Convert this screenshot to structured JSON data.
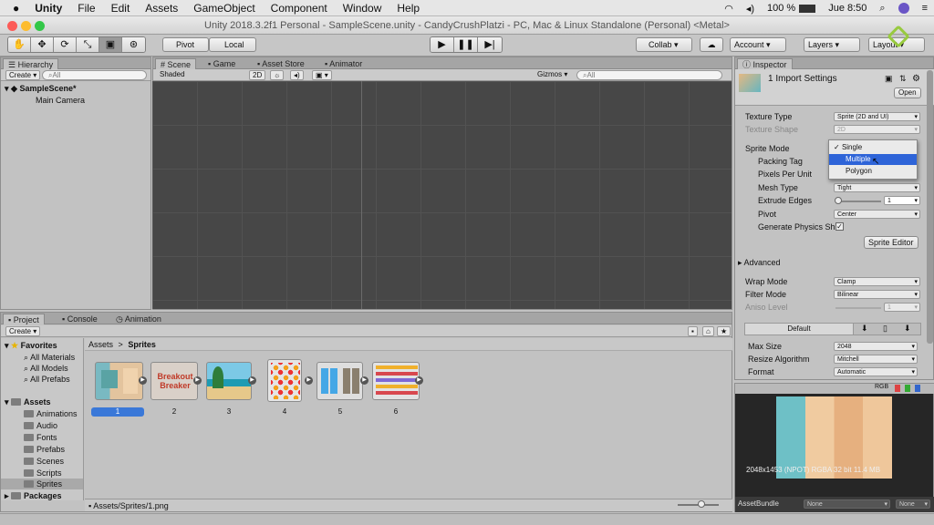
{
  "menubar": {
    "apple": "",
    "app": "Unity",
    "items": [
      "File",
      "Edit",
      "Assets",
      "GameObject",
      "Component",
      "Window",
      "Help"
    ],
    "battery": "100 %",
    "day_time": "Jue 8:50"
  },
  "window": {
    "title": "Unity 2018.3.2f1 Personal - SampleScene.unity - CandyCrushPlatzi - PC, Mac & Linux Standalone (Personal) <Metal>"
  },
  "toolbar": {
    "pivot": "Pivot",
    "local": "Local",
    "collab": "Collab",
    "account": "Account",
    "layers": "Layers",
    "layout": "Layout"
  },
  "hierarchy": {
    "tab": "Hierarchy",
    "create": "Create",
    "search": "All",
    "scene": "SampleScene*",
    "items": [
      "Main Camera"
    ]
  },
  "scene_panel": {
    "tabs": [
      "Scene",
      "Game",
      "Asset Store",
      "Animator"
    ],
    "shading": "Shaded",
    "mode2d": "2D",
    "gizmos": "Gizmos",
    "search": "All"
  },
  "inspector": {
    "tab": "Inspector",
    "header_title": "1 Import Settings",
    "open_btn": "Open",
    "props": [
      {
        "label": "Texture Type",
        "value": "Sprite (2D and UI)"
      },
      {
        "label": "Texture Shape",
        "value": "2D"
      },
      {
        "label": "Sprite Mode",
        "value": ""
      },
      {
        "label": "Packing Tag",
        "value": ""
      },
      {
        "label": "Pixels Per Unit",
        "value": ""
      },
      {
        "label": "Mesh Type",
        "value": "Tight"
      },
      {
        "label": "Extrude Edges",
        "value": "1"
      },
      {
        "label": "Pivot",
        "value": "Center"
      },
      {
        "label": "Generate Physics Sh",
        "value": ""
      }
    ],
    "sprite_mode_options": [
      "Single",
      "Multiple",
      "Polygon"
    ],
    "sprite_mode_selected": "Multiple",
    "sprite_editor": "Sprite Editor",
    "advanced": "Advanced",
    "props2": [
      {
        "label": "Wrap Mode",
        "value": "Clamp"
      },
      {
        "label": "Filter Mode",
        "value": "Bilinear"
      },
      {
        "label": "Aniso Level",
        "value": "1"
      }
    ],
    "platform_tab": "Default",
    "props3": [
      {
        "label": "Max Size",
        "value": "2048"
      },
      {
        "label": "Resize Algorithm",
        "value": "Mitchell"
      },
      {
        "label": "Format",
        "value": "Automatic"
      }
    ],
    "preview_channels": "RGB",
    "preview_info": "2048x1453 (NPOT) RGBA 32 bit 11.4 MB",
    "asset_bundle": "AssetBundle",
    "bundle_value": "None",
    "bundle_variant": "None"
  },
  "project": {
    "tabs": [
      "Project",
      "Console",
      "Animation"
    ],
    "create": "Create",
    "favorites": "Favorites",
    "favorite_items": [
      "All Materials",
      "All Models",
      "All Prefabs"
    ],
    "assets": "Assets",
    "asset_folders": [
      "Animations",
      "Audio",
      "Fonts",
      "Prefabs",
      "Scenes",
      "Scripts",
      "Sprites"
    ],
    "packages": "Packages",
    "breadcrumb_root": "Assets",
    "breadcrumb_sep": ">",
    "breadcrumb_current": "Sprites",
    "thumbs": [
      "1",
      "2",
      "3",
      "4",
      "5",
      "6"
    ],
    "thumb2_text": "Breakout Breaker",
    "status_path": "Assets/Sprites/1.png"
  }
}
